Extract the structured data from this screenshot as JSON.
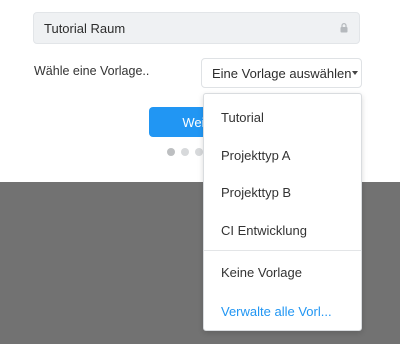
{
  "form": {
    "room_name_value": "Tutorial Raum",
    "template_label": "Wähle eine Vorlage..",
    "template_select_value": "Eine Vorlage auswählen",
    "next_button_label": "Weiter"
  },
  "dropdown": {
    "items": [
      {
        "label": "Tutorial"
      },
      {
        "label": "Projekttyp A"
      },
      {
        "label": "Projekttyp B"
      },
      {
        "label": "CI Entwicklung"
      }
    ],
    "no_template_label": "Keine Vorlage",
    "manage_link_label": "Verwalte alle Vorl..."
  },
  "pagination": {
    "total": 3,
    "current": 1
  },
  "icons": {
    "lock": "lock-icon",
    "caret": "caret-down-icon"
  },
  "colors": {
    "accent": "#2196f3",
    "backdrop": "#727272",
    "input_bg": "#eff1f3"
  }
}
